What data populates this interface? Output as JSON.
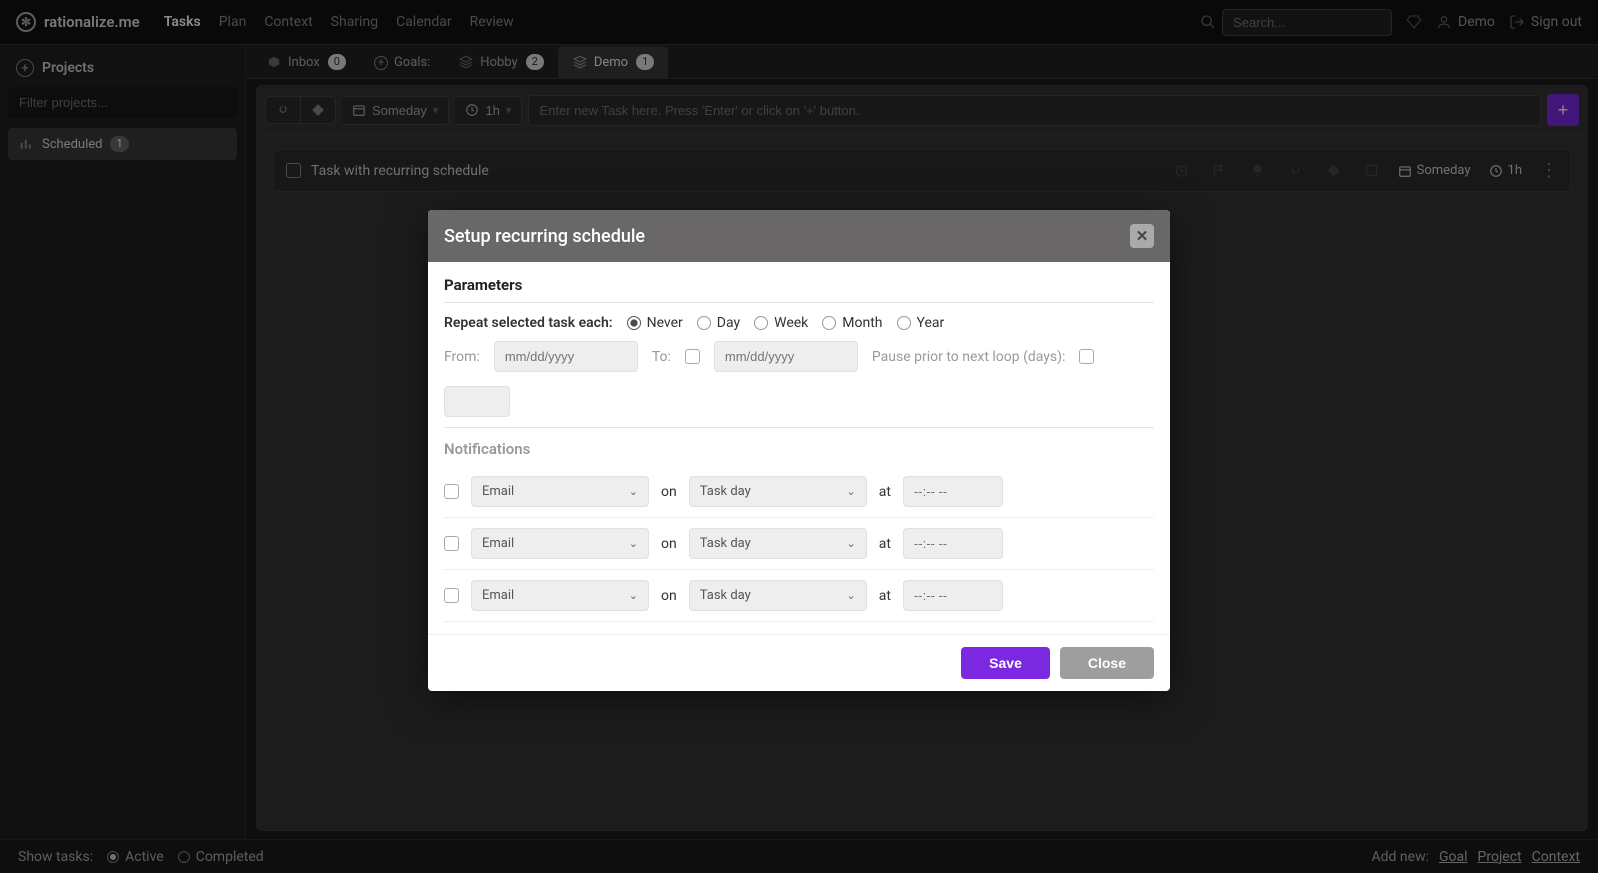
{
  "brand": "rationalize.me",
  "nav": {
    "links": [
      "Tasks",
      "Plan",
      "Context",
      "Sharing",
      "Calendar",
      "Review"
    ],
    "active": "Tasks",
    "search_placeholder": "Search...",
    "user": "Demo",
    "signout": "Sign out"
  },
  "sidebar": {
    "heading": "Projects",
    "filter_placeholder": "Filter projects...",
    "item": {
      "label": "Scheduled",
      "count": "1"
    }
  },
  "tabs": [
    {
      "label": "Inbox",
      "count": "0"
    },
    {
      "label": "Goals:"
    },
    {
      "label": "Hobby",
      "count": "2"
    },
    {
      "label": "Demo",
      "count": "1",
      "active": true
    }
  ],
  "toolbar": {
    "someday": "Someday",
    "duration": "1h",
    "input_placeholder": "Enter new Task here. Press 'Enter' or click on '+' button."
  },
  "task": {
    "title": "Task with recurring schedule",
    "someday": "Someday",
    "duration": "1h"
  },
  "footer": {
    "show_tasks": "Show tasks:",
    "active": "Active",
    "completed": "Completed",
    "add_new": "Add new:",
    "links": [
      "Goal",
      "Project",
      "Context"
    ]
  },
  "modal": {
    "title": "Setup recurring schedule",
    "parameters": "Parameters",
    "repeat_label": "Repeat selected task each:",
    "repeat_options": [
      "Never",
      "Day",
      "Week",
      "Month",
      "Year"
    ],
    "repeat_selected": "Never",
    "from": "From:",
    "to": "To:",
    "date_placeholder": "mm/dd/yyyy",
    "pause_label": "Pause prior to next loop (days):",
    "notifications": "Notifications",
    "notif_channel": "Email",
    "notif_on": "on",
    "notif_day": "Task day",
    "notif_at": "at",
    "notif_time": "--:-- --",
    "save": "Save",
    "close": "Close"
  }
}
